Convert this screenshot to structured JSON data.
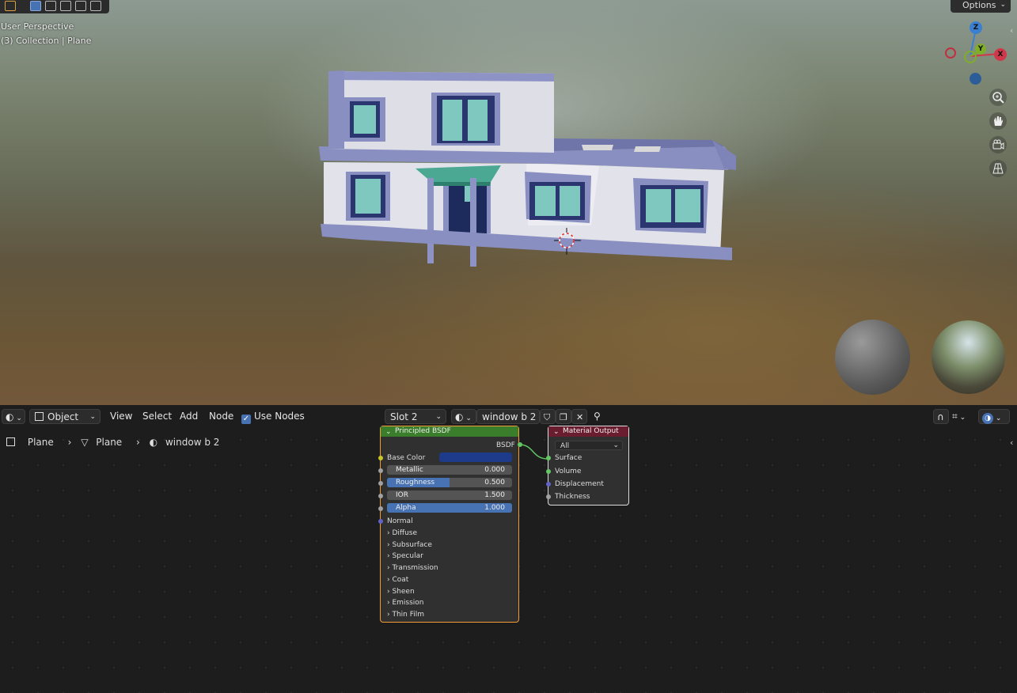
{
  "viewport": {
    "perspective_label": "User Perspective",
    "collection_label": "(3) Collection | Plane",
    "options_label": "Options",
    "gizmo": {
      "z": "Z",
      "y": "Y",
      "x": "X"
    }
  },
  "editor_header": {
    "mode_label": "Object",
    "menu": {
      "view": "View",
      "select": "Select",
      "add": "Add",
      "node": "Node"
    },
    "use_nodes_label": "Use Nodes",
    "slot_label": "Slot 2",
    "material_name": "window b 2"
  },
  "breadcrumb": {
    "object": "Plane",
    "mesh": "Plane",
    "material": "window b 2"
  },
  "bsdf_node": {
    "title": "Principled BSDF",
    "output_label": "BSDF",
    "base_color_label": "Base Color",
    "base_color": "#1e3a8a",
    "metallic": {
      "label": "Metallic",
      "value": "0.000",
      "fraction": 0.0
    },
    "roughness": {
      "label": "Roughness",
      "value": "0.500",
      "fraction": 0.5
    },
    "ior": {
      "label": "IOR",
      "value": "1.500",
      "fraction": 0.0
    },
    "alpha": {
      "label": "Alpha",
      "value": "1.000",
      "fraction": 1.0
    },
    "normal_label": "Normal",
    "panels": [
      "Diffuse",
      "Subsurface",
      "Specular",
      "Transmission",
      "Coat",
      "Sheen",
      "Emission",
      "Thin Film"
    ]
  },
  "output_node": {
    "title": "Material Output",
    "target": "All",
    "inputs": [
      "Surface",
      "Volume",
      "Displacement",
      "Thickness"
    ]
  },
  "colors": {
    "accent": "#4772b3",
    "node_selected": "#f29b37",
    "shader_header": "#3a7d2a",
    "output_header": "#6b1d30"
  }
}
